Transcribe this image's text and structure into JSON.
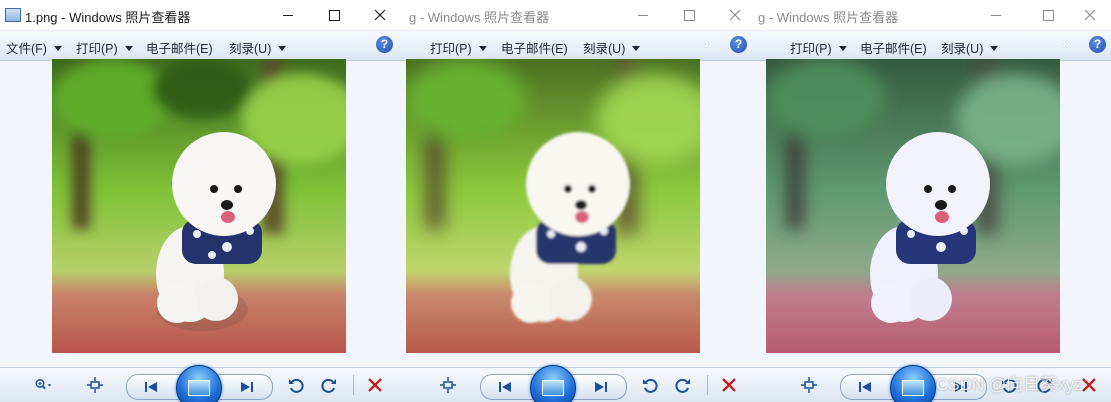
{
  "windows": [
    {
      "title": "1.png - Windows 照片查看器",
      "menu": [
        "文件(F)",
        "打印(P)",
        "电子邮件(E)",
        "刻录(U)"
      ],
      "help": "?",
      "image_tone": "original"
    },
    {
      "title": "g - Windows 照片查看器",
      "menu": [
        "打印(P)",
        "电子邮件(E)",
        "刻录(U)"
      ],
      "help": "?",
      "image_tone": "soft-blur"
    },
    {
      "title": "g - Windows 照片查看器",
      "menu": [
        "打印(P)",
        "电子邮件(E)",
        "刻录(U)"
      ],
      "help": "?",
      "image_tone": "cool-faded"
    }
  ],
  "toolbar_icons": [
    "zoom-icon",
    "fit-to-window-icon",
    "previous-icon",
    "slideshow-icon",
    "next-icon",
    "rotate-left-icon",
    "rotate-right-icon",
    "delete-icon"
  ],
  "watermark": "CSDN @向日葵xyz",
  "colors": {
    "delete_red": "#c62020",
    "nav_blue": "#1d4f9c",
    "orb_blue": "#1e6fd8"
  }
}
